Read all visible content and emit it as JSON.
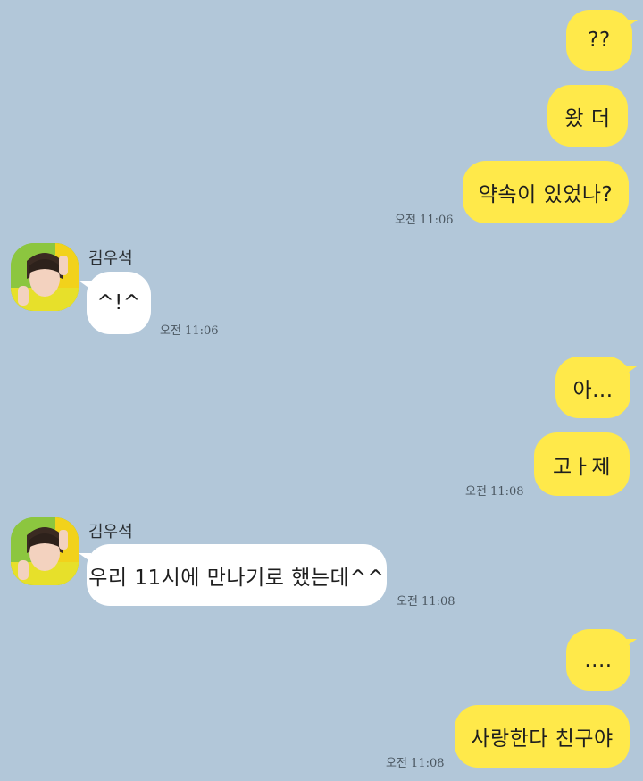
{
  "chat": {
    "contact_name": "김우석",
    "messages": [
      {
        "text": "??"
      },
      {
        "text": "왔 더"
      },
      {
        "text": "약속이 있었나?"
      },
      {
        "text": "^!^"
      },
      {
        "text": "아..."
      },
      {
        "text": "고ㅏ제"
      },
      {
        "text": "우리 11시에 만나기로 했는데^^"
      },
      {
        "text": "...."
      },
      {
        "text": "사랑한다 친구야"
      }
    ],
    "times": {
      "t1": "오전 11:06",
      "t2": "오전 11:06",
      "t3": "오전 11:08",
      "t4": "오전 11:08",
      "t5": "오전 11:08"
    }
  },
  "colors": {
    "background": "#b2c7d9",
    "my_bubble": "#ffe94a",
    "other_bubble": "#ffffff"
  },
  "icons": {
    "avatar": "profile-photo"
  }
}
